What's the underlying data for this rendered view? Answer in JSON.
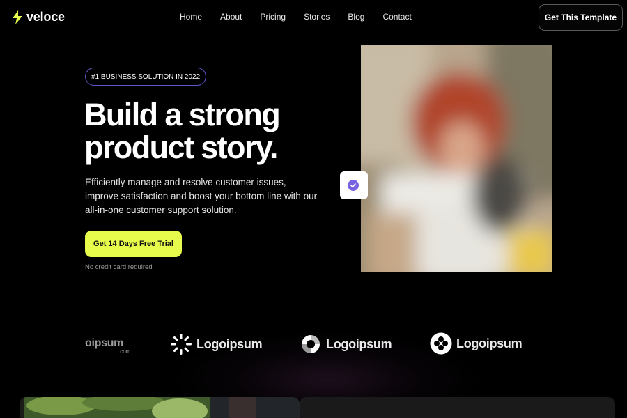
{
  "brand": {
    "name": "veloce",
    "accent": "#e6fb4b"
  },
  "nav": {
    "links": [
      "Home",
      "About",
      "Pricing",
      "Stories",
      "Blog",
      "Contact"
    ],
    "cta": "Get This Template"
  },
  "hero": {
    "badge": "#1 BUSINESS SOLUTION IN 2022",
    "headline": "Build a strong product story.",
    "subtext": "Efficiently manage and resolve customer issues, improve satisfaction and boost your bottom line with our all-in-one customer support solution.",
    "cta": "Get 14 Days Free Trial",
    "note": "No credit card required",
    "verify_color": "#7a63e0"
  },
  "logos": {
    "partial": "oipsum",
    "partial_sub": ".com",
    "items": [
      {
        "icon": "sunburst-icon",
        "label": "Logoipsum"
      },
      {
        "icon": "ring-icon",
        "label": "Logoipsum"
      },
      {
        "icon": "clover-icon",
        "label": "Logoipsum"
      }
    ]
  }
}
